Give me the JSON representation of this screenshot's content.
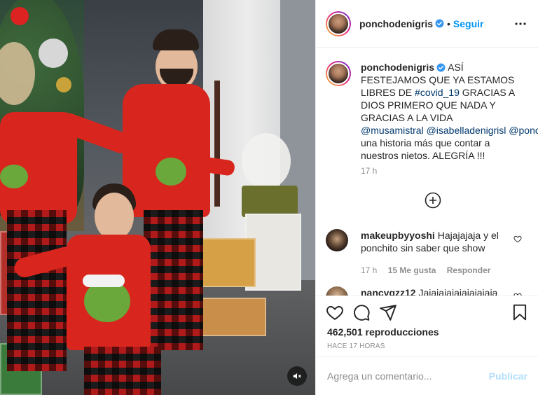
{
  "post": {
    "author": "ponchodenigris",
    "follow_label": "Seguir",
    "separator": "•",
    "caption": {
      "part1": "ASÍ FESTEJAMOS QUE YA ESTAMOS LIBRES DE ",
      "hashtag": "#covid_19",
      "part2": " GRACIAS A DIOS PRIMERO QUE NADA Y GRACIAS A LA VIDA ",
      "mention1": "@musamistral",
      "mention2": "@isabelladenigrisl",
      "mention3": "@ponchitodenigris",
      "part3": " una historia más que contar a nuestros nietos. ALEGRÍA !!!"
    },
    "caption_time": "17 h",
    "views": "462,501 reproducciones",
    "date": "HACE 17 HORAS"
  },
  "comments": [
    {
      "user": "makeupbyyoshi",
      "text": "Hajajajaja y el ponchito sin saber que show",
      "time": "17 h",
      "likes": "15 Me gusta",
      "reply": "Responder"
    },
    {
      "user": "nancygzz12",
      "text": "Jajajajajajajajajaja"
    }
  ],
  "add_comment": {
    "placeholder": "Agrega un comentario...",
    "publish_label": "Publicar"
  },
  "colors": {
    "accent": "#0095f6",
    "link": "#00376b",
    "muted": "#8e8e8e",
    "publish_disabled": "#b2dffc"
  },
  "icons": [
    "verified-badge-icon",
    "more-options-icon",
    "load-more-icon",
    "heart-icon",
    "comment-icon",
    "share-icon",
    "bookmark-icon",
    "mute-icon"
  ]
}
